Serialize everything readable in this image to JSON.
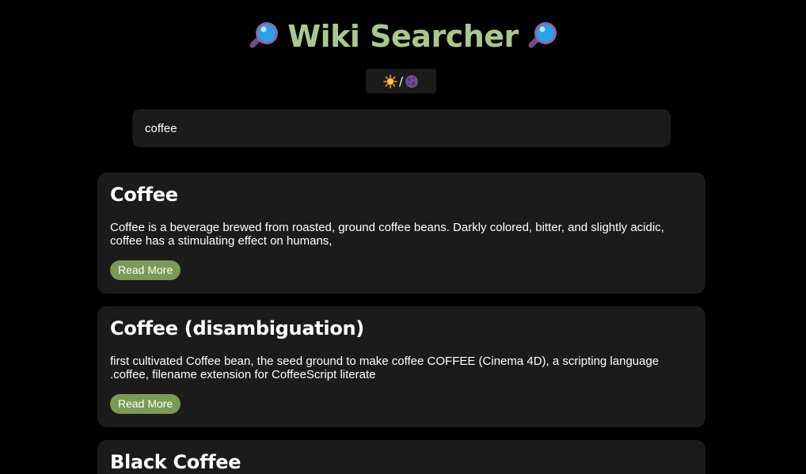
{
  "header": {
    "title": "Wiki Searcher",
    "left_icon": "magnifying-glass-icon",
    "right_icon": "magnifying-glass-icon"
  },
  "theme_toggle": {
    "separator": "/",
    "light_icon": "sun-icon",
    "dark_icon": "moon-icon"
  },
  "search": {
    "value": "coffee"
  },
  "results": [
    {
      "title": "Coffee",
      "snippet": "Coffee is a beverage brewed from roasted, ground coffee beans. Darkly colored, bitter, and slightly acidic, coffee has a stimulating effect on humans,",
      "button_label": "Read More"
    },
    {
      "title": "Coffee (disambiguation)",
      "snippet": "first cultivated Coffee bean, the seed ground to make coffee COFFEE (Cinema 4D), a scripting language .coffee, filename extension for CoffeeScript literate",
      "button_label": "Read More"
    },
    {
      "title": "Black Coffee"
    }
  ],
  "colors": {
    "background": "#000000",
    "panel": "#1b1b1b",
    "title": "#a8c98c",
    "button": "#7a9a56"
  }
}
